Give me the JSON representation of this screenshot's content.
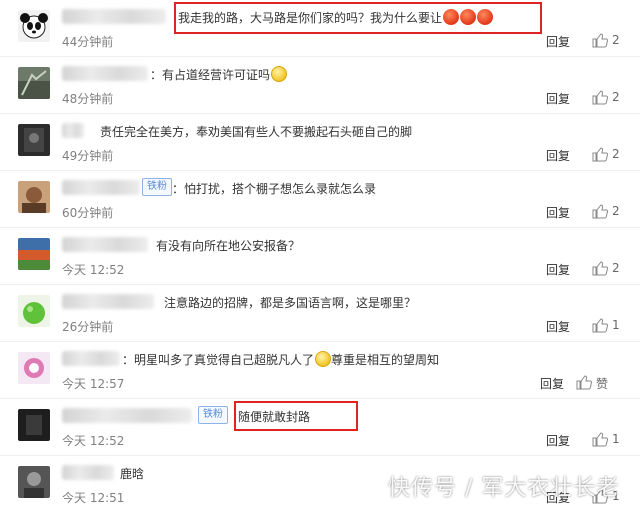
{
  "comments": [
    {
      "text": "我走我的路，大马路是你们家的吗？我为什么要让",
      "time": "44分钟前",
      "reply": "回复",
      "like_count": "2"
    },
    {
      "text": "：有占道经营许可证吗",
      "time": "48分钟前",
      "reply": "回复",
      "like_count": "2"
    },
    {
      "text": "责任完全在美方，奉劝美国有些人不要搬起石头砸自己的脚",
      "time": "49分钟前",
      "reply": "回复",
      "like_count": "2"
    },
    {
      "text": "：怕打扰，搭个棚子想怎么录就怎么录",
      "time": "60分钟前",
      "reply": "回复",
      "like_count": "2",
      "badge": "铁粉"
    },
    {
      "text": "有没有向所在地公安报备？",
      "time": "今天 12:52",
      "reply": "回复",
      "like_count": "2"
    },
    {
      "text": "注意路边的招牌，都是多国语言啊，这是哪里？",
      "time": "26分钟前",
      "reply": "回复",
      "like_count": "1",
      "name_fragment": "聪明的评论员"
    },
    {
      "text": "：明星叫多了真觉得自己超脱凡人了",
      "text_after": "尊重是相互的望周知",
      "time": "今天 12:57",
      "reply": "回复",
      "like_label": "赞"
    },
    {
      "text": "随便就敢封路",
      "time": "今天 12:52",
      "reply": "回复",
      "like_count": "1",
      "badge": "铁粉"
    },
    {
      "text": "鹿晗",
      "time": "今天 12:51",
      "reply": "回复",
      "like_count": "1"
    }
  ],
  "watermark": "快传号 / 军大衣壮长老"
}
